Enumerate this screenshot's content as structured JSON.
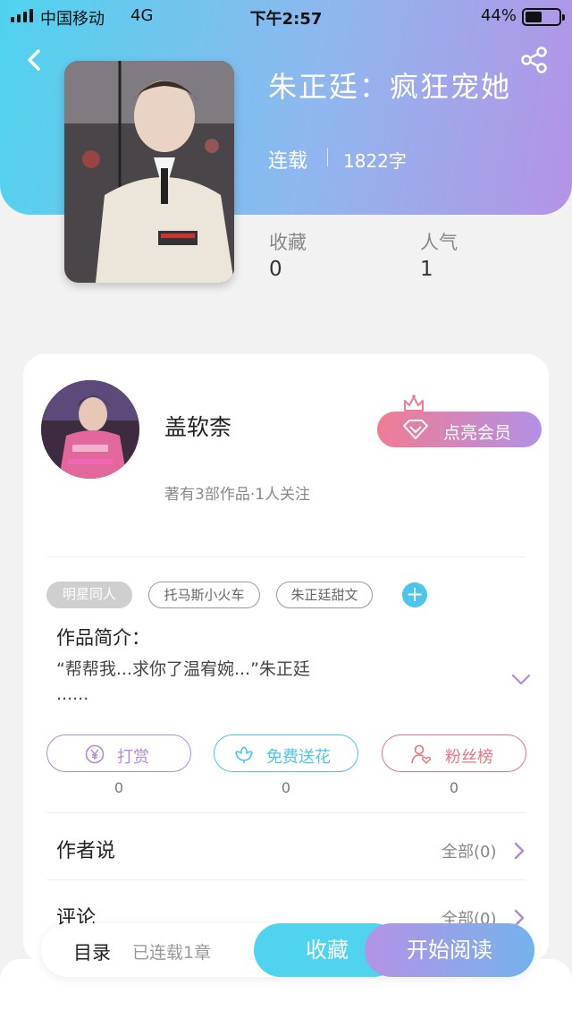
{
  "status_bar": {
    "carrier": "中国移动",
    "network": "4G",
    "time": "下午2:57",
    "battery": "44%"
  },
  "header": {
    "back_icon": "chevron-left-icon",
    "share_icon": "share-icon"
  },
  "book": {
    "title": "朱正廷：疯狂宠她",
    "status": "连载",
    "word_count": "1822字"
  },
  "stats": [
    {
      "label": "收藏",
      "value": "0"
    },
    {
      "label": "人气",
      "value": "1"
    }
  ],
  "author": {
    "name": "盖软柰",
    "meta": "著有3部作品·1人关注",
    "vip_label": "点亮会员"
  },
  "tags": [
    "明星同人",
    "托马斯小火车",
    "朱正廷甜文"
  ],
  "intro": {
    "title": "作品简介：",
    "line1": "“帮帮我...求你了温宥婉...”朱正廷",
    "line2": "......"
  },
  "actions": [
    {
      "label": "打赏",
      "count": "0",
      "icon": "yen-coin-icon",
      "color": "#b18ad9"
    },
    {
      "label": "免费送花",
      "count": "0",
      "icon": "flower-icon",
      "color": "#4dc4ec"
    },
    {
      "label": "粉丝榜",
      "count": "0",
      "icon": "user-heart-icon",
      "color": "#e8747c"
    }
  ],
  "sections": [
    {
      "title": "作者说",
      "link": "全部(0)"
    },
    {
      "title": "评论",
      "link": "全部(0)"
    }
  ],
  "bottom_bar": {
    "toc": "目录",
    "chapters": "已连载1章",
    "collect": "收藏",
    "read": "开始阅读"
  },
  "colors": {
    "cyan": "#4fd3ee",
    "purple": "#b493e6",
    "pink": "#f17b94"
  }
}
